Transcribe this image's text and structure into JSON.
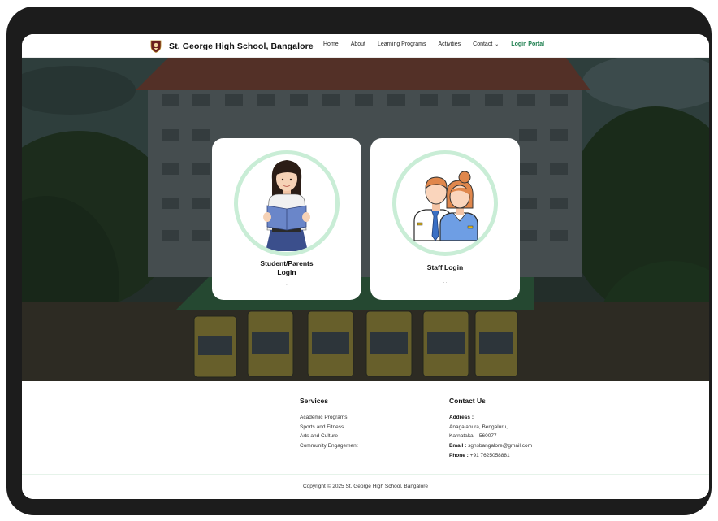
{
  "navbar": {
    "brand_name": "St. George High School, Bangalore",
    "links": [
      {
        "label": "Home"
      },
      {
        "label": "About"
      },
      {
        "label": "Learning Programs"
      },
      {
        "label": "Activities"
      },
      {
        "label": "Contact"
      },
      {
        "label": "Login Portal"
      }
    ],
    "accent_color": "#1a7d4c"
  },
  "hero": {
    "cards": [
      {
        "label": "Student/Parents Login",
        "icon": "student-reading-icon",
        "footnote": "."
      },
      {
        "label": "Staff Login",
        "icon": "staff-members-icon",
        "footnote": ". ."
      }
    ],
    "ring_color": "#c9edd6"
  },
  "footer": {
    "services": {
      "title": "Services",
      "items": [
        "Academic Programs",
        "Sports and Fitness",
        "Arts and Culture",
        "Community Engagement"
      ]
    },
    "contact": {
      "title": "Contact Us",
      "address_label": "Address :",
      "address_line1": "Anagalapura, Bengaluru,",
      "address_line2": "Karnataka – 560077",
      "email_label": "Email :",
      "email_value": "sghsbangalore@gmail.com",
      "phone_label": "Phone :",
      "phone_value": "+91 7625058881"
    },
    "copyright": "Copyright © 2025 St. George High School, Bangalore"
  }
}
